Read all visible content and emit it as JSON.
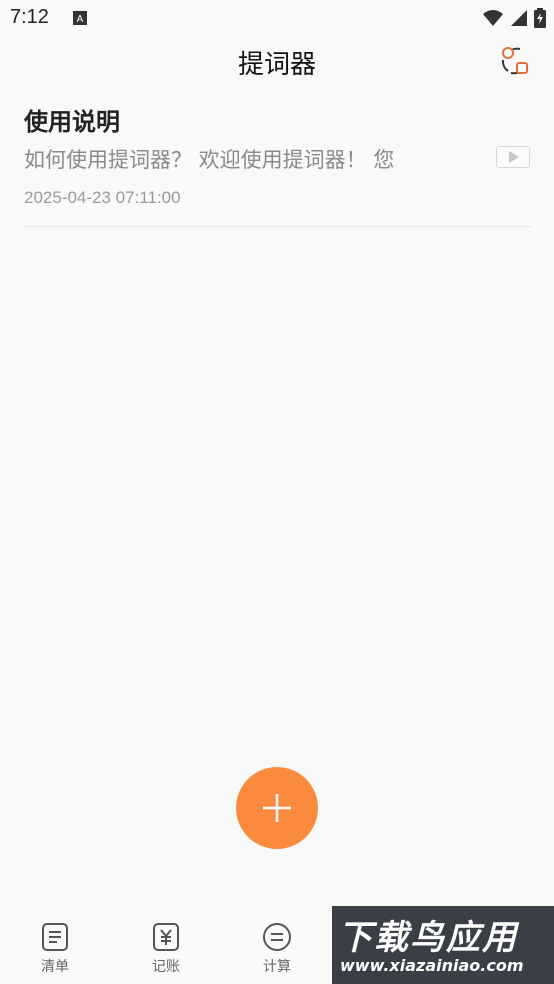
{
  "status_bar": {
    "time": "7:12"
  },
  "app_bar": {
    "title": "提词器"
  },
  "notes": [
    {
      "title": "使用说明",
      "preview": "如何使用提词器？ 欢迎使用提词器！ 您",
      "date": "2025-04-23 07:11:00"
    }
  ],
  "tabs": [
    {
      "label": "清单",
      "icon": "list-icon"
    },
    {
      "label": "记账",
      "icon": "yuan-icon"
    },
    {
      "label": "计算",
      "icon": "equals-icon"
    }
  ],
  "watermark": {
    "brand": "下载鸟应用",
    "url": "www.xiazainiao.com"
  },
  "colors": {
    "accent": "#fa8a3e",
    "background": "#f9f9f9"
  }
}
